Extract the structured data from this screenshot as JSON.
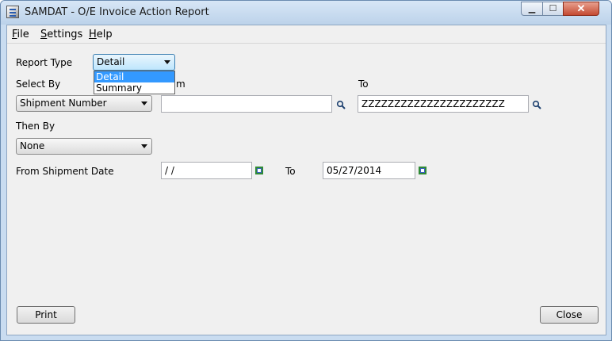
{
  "window": {
    "title": "SAMDAT - O/E Invoice Action Report",
    "controls": {
      "minimize": "▁",
      "maximize": "☐",
      "close": "✕"
    }
  },
  "menu": [
    "File",
    "Settings",
    "Help"
  ],
  "form": {
    "report_type_label": "Report Type",
    "report_type_value": "Detail",
    "report_type_options": [
      "Detail",
      "Summary"
    ],
    "select_by_label": "Select By",
    "select_by_value": "Shipment Number",
    "from_label_partial": "m",
    "to_label": "To",
    "from_value": "",
    "to_value": "ZZZZZZZZZZZZZZZZZZZZZZ",
    "then_by_label": "Then By",
    "then_by_value": "None",
    "date_label": "From Shipment Date",
    "date_from_value": " / /",
    "date_to_label": "To",
    "date_to_value": "05/27/2014"
  },
  "buttons": {
    "print": "Print",
    "close": "Close"
  },
  "icons": {
    "lookup": "magnifier-icon",
    "calendar": "calendar-icon"
  },
  "colors": {
    "selection": "#3399ff",
    "calendar_green": "#2f8a36",
    "title_bg": "#c9dcf0"
  }
}
